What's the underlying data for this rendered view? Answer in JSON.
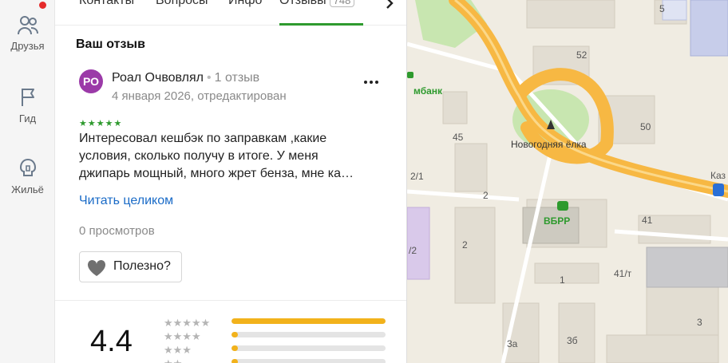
{
  "sidebar": {
    "items": [
      {
        "label": "Друзья",
        "icon": "friends-icon",
        "has_notification": true
      },
      {
        "label": "Гид",
        "icon": "flag-icon"
      },
      {
        "label": "Жильё",
        "icon": "housing-icon"
      }
    ],
    "notification_color": "#e52b2b"
  },
  "tabs": {
    "items": [
      "Контакты",
      "Вопросы",
      "Инфо",
      "Отзывы"
    ],
    "active": "Отзывы",
    "reviews_count": "748",
    "accent": "#2e9a2e"
  },
  "review": {
    "section_title": "Ваш отзыв",
    "author_initials": "РО",
    "author_name": "Роал Очвовлял",
    "separator": "•",
    "author_reviews": "1 отзыв",
    "date": "4 января 2026, отредактирован",
    "stars": "★★★★★",
    "rating": 5,
    "text_lines": [
      "Интересовал кешбэк по заправкам ,какие",
      "условия, сколько получу в итоге. У меня",
      "джипарь мощный, много жрет бенза, мне ка…"
    ],
    "read_more": "Читать целиком",
    "views": "0 просмотров",
    "useful_label": "Полезно?",
    "avatar_color": "#9b3aa8"
  },
  "rating_summary": {
    "value": "4.4",
    "rows": [
      {
        "stars": "★★★★★",
        "fraction": 1.0
      },
      {
        "stars": "★★★★",
        "fraction": 0.04
      },
      {
        "stars": "★★★",
        "fraction": 0.04
      },
      {
        "stars": "★★",
        "fraction": 0.04
      }
    ],
    "bar_color": "#f2b21b"
  },
  "map": {
    "labels": {
      "bank": "мбанк",
      "vbrr": "ВБРР",
      "tree": "Новогодняя ёлка",
      "kaz": "Каз",
      "n52": "52",
      "n50": "50",
      "n45": "45",
      "n41": "41",
      "n41t": "41/т",
      "n21": "2/1",
      "n22": "/2",
      "n2a": "2",
      "n2b": "2",
      "n1": "1",
      "n3a": "3а",
      "n3b": "3б",
      "n5": "5",
      "n3": "3"
    },
    "road_color": "#f7b843",
    "park_color": "#c8e6b0"
  }
}
